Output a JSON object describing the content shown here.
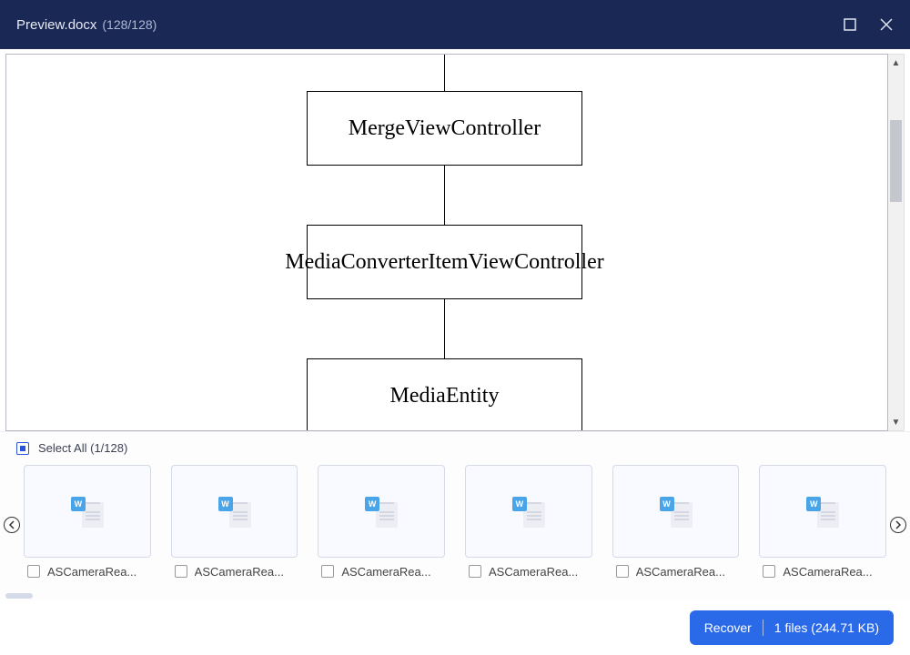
{
  "title": {
    "prefix": "Preview",
    "filename": ".docx",
    "counter": "(128/128)"
  },
  "diagram": {
    "box1": "MergeViewController",
    "box2": "MediaConverterItemViewController",
    "box3": "MediaEntity"
  },
  "select_all": {
    "label": "Select All",
    "counter": "(1/128)"
  },
  "thumbs": [
    {
      "label": "ASCameraRea...",
      "icon_letter": "W"
    },
    {
      "label": "ASCameraRea...",
      "icon_letter": "W"
    },
    {
      "label": "ASCameraRea...",
      "icon_letter": "W"
    },
    {
      "label": "ASCameraRea...",
      "icon_letter": "W"
    },
    {
      "label": "ASCameraRea...",
      "icon_letter": "W"
    },
    {
      "label": "ASCameraRea...",
      "icon_letter": "W"
    }
  ],
  "footer": {
    "recover_label": "Recover",
    "file_info": "1 files (244.71 KB)"
  }
}
